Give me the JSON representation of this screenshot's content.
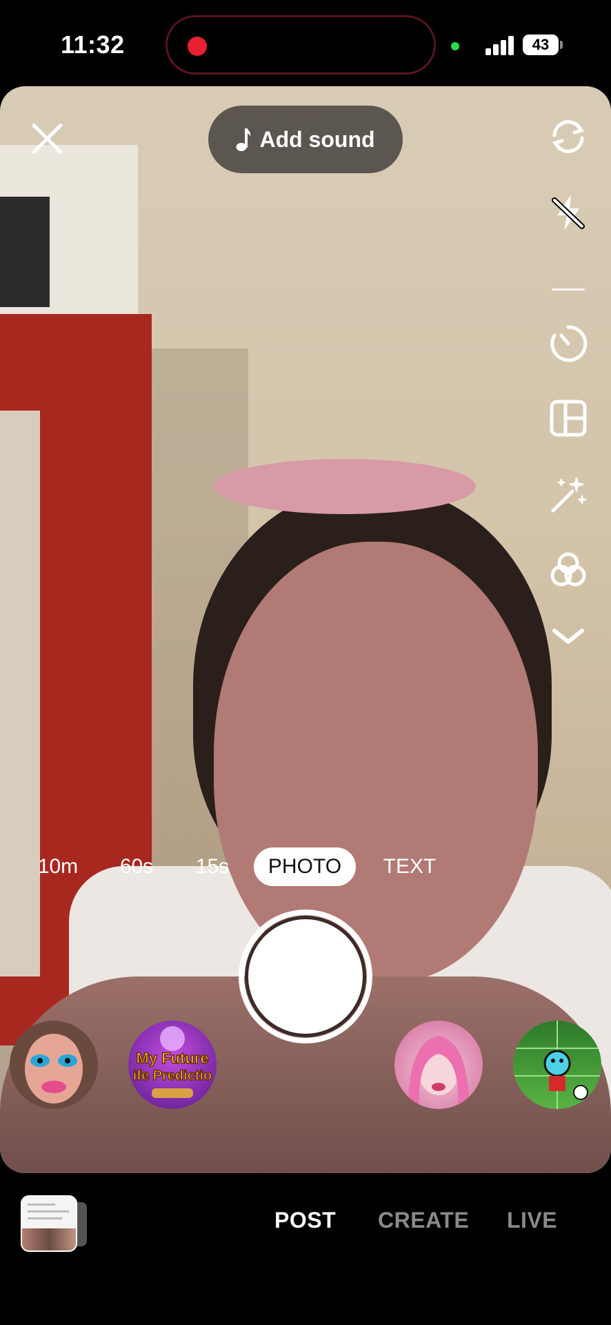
{
  "status_bar": {
    "time": "11:32",
    "battery": "43",
    "recording_indicator_color": "#e8202f",
    "camera_in_use_color": "#2bd94a"
  },
  "top": {
    "close_icon": "close-icon",
    "add_sound_label": "Add sound",
    "add_sound_icon": "music-note-icon"
  },
  "side_tools": [
    {
      "icon": "flip-camera-icon"
    },
    {
      "icon": "flash-off-icon"
    },
    {
      "icon": "timer-icon"
    },
    {
      "icon": "layout-icon"
    },
    {
      "icon": "effects-sparkle-icon"
    },
    {
      "icon": "filters-icon"
    },
    {
      "icon": "chevron-down-icon"
    }
  ],
  "mode_tabs": {
    "items": [
      "10m",
      "60s",
      "15s",
      "PHOTO",
      "TEXT"
    ],
    "selected": "PHOTO"
  },
  "effects": [
    {
      "icon": "effect-makeup-face-icon"
    },
    {
      "icon": "effect-future-prediction-icon",
      "text": "My Future Life Prediction"
    },
    {
      "icon": "effect-pink-hair-icon"
    },
    {
      "icon": "effect-soccer-game-icon"
    }
  ],
  "bottom_tabs": {
    "items": [
      "POST",
      "CREATE",
      "LIVE"
    ],
    "selected": "POST"
  }
}
